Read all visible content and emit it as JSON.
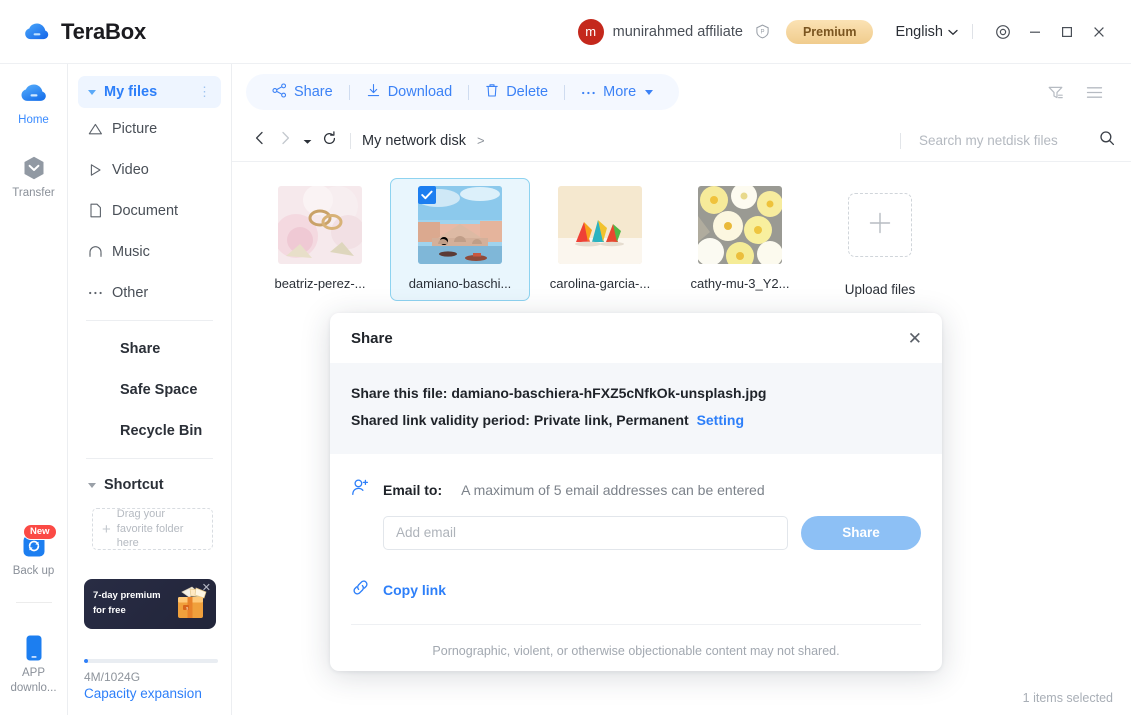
{
  "header": {
    "brand": "TeraBox",
    "brand_logo_icon": "cloud-logo-icon",
    "avatar_initial": "m",
    "user_name": "munirahmed affiliate",
    "premium_badge_icon": "premium-p-icon",
    "premium_label": "Premium",
    "language": "English",
    "chevron_icon": "chevron-down-icon",
    "settings_icon": "settings-target-icon",
    "minimize_icon": "minimize-icon",
    "maximize_icon": "maximize-icon",
    "close_icon": "close-icon"
  },
  "rail": {
    "items": [
      {
        "label": "Home",
        "icon": "cloud-home-icon",
        "active": true,
        "badge": ""
      },
      {
        "label": "Transfer",
        "icon": "transfer-hexagon-icon",
        "active": false,
        "badge": ""
      },
      {
        "label": "Back up",
        "icon": "backup-sync-icon",
        "active": false,
        "badge": "New"
      },
      {
        "label": "APP downlo...",
        "icon": "app-download-icon",
        "active": false,
        "badge": ""
      }
    ]
  },
  "sidebar": {
    "my_files_label": "My files",
    "my_files_kebab_icon": "kebab-menu-icon",
    "categories": [
      {
        "label": "Picture",
        "icon": "picture-icon"
      },
      {
        "label": "Video",
        "icon": "video-play-icon"
      },
      {
        "label": "Document",
        "icon": "document-icon"
      },
      {
        "label": "Music",
        "icon": "music-headphone-icon"
      },
      {
        "label": "Other",
        "icon": "other-ellipsis-icon"
      }
    ],
    "links": [
      "Share",
      "Safe Space",
      "Recycle Bin"
    ],
    "shortcut_label": "Shortcut",
    "dropzone_text": "Drag your favorite folder here",
    "dropzone_plus_icon": "plus-icon",
    "promo_line1": "7-day premium",
    "promo_line2": "for free",
    "promo_close_icon": "close-icon",
    "promo_gift_icon": "gift-box-icon",
    "capacity_used": "4M/1024G",
    "capacity_link": "Capacity expansion"
  },
  "toolbar": {
    "share_label": "Share",
    "share_icon": "share-nodes-icon",
    "download_label": "Download",
    "download_icon": "download-icon",
    "delete_label": "Delete",
    "delete_icon": "trash-icon",
    "more_label": "More",
    "more_icon": "ellipsis-icon",
    "filter_icon": "filter-icon",
    "list-view_icon": "list-view-icon"
  },
  "breadcrumb": {
    "back_icon": "chevron-left-icon",
    "forward_icon": "chevron-right-icon",
    "history_icon": "caret-down-icon",
    "refresh_icon": "refresh-icon",
    "path": "My network disk",
    "separator": ">",
    "search_placeholder": "Search my netdisk files",
    "search_value": "",
    "search_icon": "search-icon"
  },
  "files": [
    {
      "name": "beatriz-perez-...",
      "selected": false,
      "thumb": "wedding-rings-flowers"
    },
    {
      "name": "damiano-baschi...",
      "selected": true,
      "thumb": "venice-rialto-bridge"
    },
    {
      "name": "carolina-garcia-...",
      "selected": false,
      "thumb": "origami-cranes"
    },
    {
      "name": "cathy-mu-3_Y2...",
      "selected": false,
      "thumb": "yellow-paper-flowers"
    }
  ],
  "upload": {
    "label": "Upload files",
    "icon": "plus-icon"
  },
  "status": {
    "selected_count_text": "1 items selected"
  },
  "modal": {
    "title": "Share",
    "close_icon": "close-icon",
    "file_line_prefix": "Share this file:",
    "file_name": "damiano-baschiera-hFXZ5cNfkOk-unsplash.jpg",
    "validity_prefix": "Shared link validity period:",
    "validity_value": "Private link, Permanent",
    "setting_link": "Setting",
    "email_icon": "add-user-icon",
    "email_label": "Email to:",
    "email_hint": "A maximum of 5 email addresses can be entered",
    "email_placeholder": "Add email",
    "email_value": "",
    "share_button": "Share",
    "copy_link_icon": "link-chain-icon",
    "copy_link_label": "Copy link",
    "footer_note": "Pornographic, violent, or otherwise objectionable content may not shared."
  },
  "colors": {
    "accent_blue": "#2d7ff9",
    "tool_blue": "#3c82f6",
    "selection_bg": "#e9f6fd",
    "selection_border": "#8ed3f0",
    "premium_gold": "#f0cc8d",
    "avatar_red": "#c4281c",
    "new_badge_red": "#fb4a45",
    "share_btn_blue": "#8dc0f5"
  }
}
